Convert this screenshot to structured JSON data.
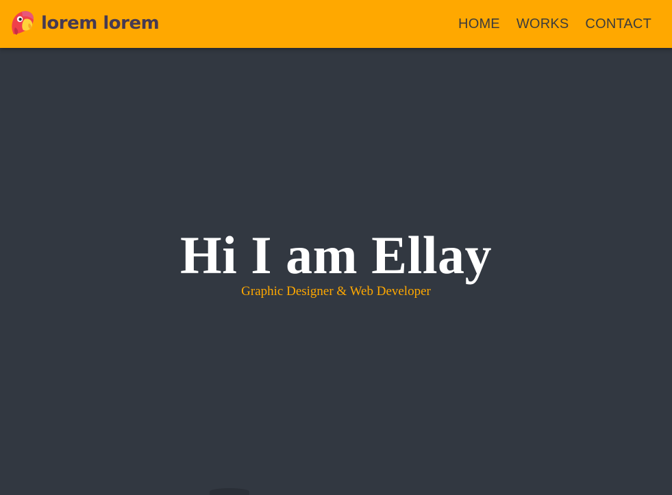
{
  "brand": {
    "name": "lorem lorem",
    "icon": "parrot-logo-icon",
    "colors": {
      "accent": "#FFA800",
      "icon_red": "#F0404A",
      "icon_pink": "#E8577A",
      "icon_yellow": "#FFD33A",
      "text_dark": "#463A52"
    }
  },
  "nav": {
    "items": [
      {
        "label": "HOME"
      },
      {
        "label": "WORKS"
      },
      {
        "label": "CONTACT"
      }
    ]
  },
  "hero": {
    "title": "Hi I am Ellay",
    "subtitle": "Graphic Designer & Web Developer",
    "background": "#323841",
    "title_color": "#FFFFFF",
    "subtitle_color": "#FFA800"
  }
}
